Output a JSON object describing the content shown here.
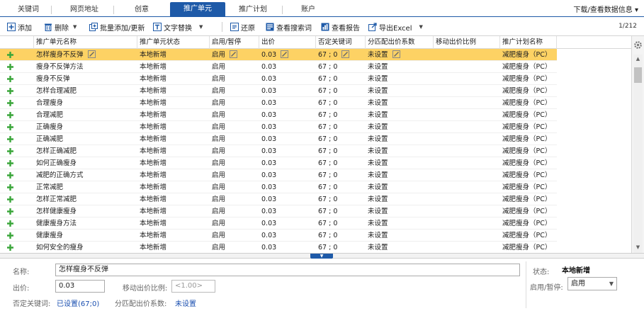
{
  "tabs": [
    {
      "label": "关键词",
      "active": false
    },
    {
      "label": "网页地址",
      "active": false
    },
    {
      "label": "创意",
      "active": false
    },
    {
      "label": "推广单元",
      "active": true
    },
    {
      "label": "推广计划",
      "active": false
    },
    {
      "label": "账户",
      "active": false
    }
  ],
  "header": {
    "download_link": "下载/查看数据信息 ▾"
  },
  "toolbar": {
    "add": "添加",
    "delete": "删除",
    "batch": "批量添加/更新",
    "replace": "文字替换",
    "restore": "还原",
    "search_terms": "查看搜索词",
    "report": "查看报告",
    "export": "导出Excel",
    "pager": "1/212"
  },
  "columns": [
    "推广单元名称",
    "推广单元状态",
    "启用/暂停",
    "出价",
    "否定关键词",
    "分匹配出价系数",
    "移动出价比例",
    "推广计划名称"
  ],
  "rows": [
    {
      "name": "怎样瘦身不反弹",
      "status": "本地新增",
      "enabled": "启用",
      "bid": "0.03",
      "neg": "67 ; 0",
      "match": "未设置",
      "mobile": "",
      "plan": "减肥瘦身（PC）",
      "selected": true
    },
    {
      "name": "瘦身不反弹方法",
      "status": "本地新增",
      "enabled": "启用",
      "bid": "0.03",
      "neg": "67 ; 0",
      "match": "未设置",
      "mobile": "",
      "plan": "减肥瘦身（PC）"
    },
    {
      "name": "瘦身不反弹",
      "status": "本地新增",
      "enabled": "启用",
      "bid": "0.03",
      "neg": "67 ; 0",
      "match": "未设置",
      "mobile": "",
      "plan": "减肥瘦身（PC）"
    },
    {
      "name": "怎样合理减肥",
      "status": "本地新增",
      "enabled": "启用",
      "bid": "0.03",
      "neg": "67 ; 0",
      "match": "未设置",
      "mobile": "",
      "plan": "减肥瘦身（PC）"
    },
    {
      "name": "合理瘦身",
      "status": "本地新增",
      "enabled": "启用",
      "bid": "0.03",
      "neg": "67 ; 0",
      "match": "未设置",
      "mobile": "",
      "plan": "减肥瘦身（PC）"
    },
    {
      "name": "合理减肥",
      "status": "本地新增",
      "enabled": "启用",
      "bid": "0.03",
      "neg": "67 ; 0",
      "match": "未设置",
      "mobile": "",
      "plan": "减肥瘦身（PC）"
    },
    {
      "name": "正确瘦身",
      "status": "本地新增",
      "enabled": "启用",
      "bid": "0.03",
      "neg": "67 ; 0",
      "match": "未设置",
      "mobile": "",
      "plan": "减肥瘦身（PC）"
    },
    {
      "name": "正确减肥",
      "status": "本地新增",
      "enabled": "启用",
      "bid": "0.03",
      "neg": "67 ; 0",
      "match": "未设置",
      "mobile": "",
      "plan": "减肥瘦身（PC）"
    },
    {
      "name": "怎样正确减肥",
      "status": "本地新增",
      "enabled": "启用",
      "bid": "0.03",
      "neg": "67 ; 0",
      "match": "未设置",
      "mobile": "",
      "plan": "减肥瘦身（PC）"
    },
    {
      "name": "如何正确瘦身",
      "status": "本地新增",
      "enabled": "启用",
      "bid": "0.03",
      "neg": "67 ; 0",
      "match": "未设置",
      "mobile": "",
      "plan": "减肥瘦身（PC）"
    },
    {
      "name": "减肥的正确方式",
      "status": "本地新增",
      "enabled": "启用",
      "bid": "0.03",
      "neg": "67 ; 0",
      "match": "未设置",
      "mobile": "",
      "plan": "减肥瘦身（PC）"
    },
    {
      "name": "正常减肥",
      "status": "本地新增",
      "enabled": "启用",
      "bid": "0.03",
      "neg": "67 ; 0",
      "match": "未设置",
      "mobile": "",
      "plan": "减肥瘦身（PC）"
    },
    {
      "name": "怎样正常减肥",
      "status": "本地新增",
      "enabled": "启用",
      "bid": "0.03",
      "neg": "67 ; 0",
      "match": "未设置",
      "mobile": "",
      "plan": "减肥瘦身（PC）"
    },
    {
      "name": "怎样健康瘦身",
      "status": "本地新增",
      "enabled": "启用",
      "bid": "0.03",
      "neg": "67 ; 0",
      "match": "未设置",
      "mobile": "",
      "plan": "减肥瘦身（PC）"
    },
    {
      "name": "健康瘦身方法",
      "status": "本地新增",
      "enabled": "启用",
      "bid": "0.03",
      "neg": "67 ; 0",
      "match": "未设置",
      "mobile": "",
      "plan": "减肥瘦身（PC）"
    },
    {
      "name": "健康瘦身",
      "status": "本地新增",
      "enabled": "启用",
      "bid": "0.03",
      "neg": "67 ; 0",
      "match": "未设置",
      "mobile": "",
      "plan": "减肥瘦身（PC）"
    },
    {
      "name": "如何安全的瘦身",
      "status": "本地新增",
      "enabled": "启用",
      "bid": "0.03",
      "neg": "67 ; 0",
      "match": "未设置",
      "mobile": "",
      "plan": "减肥瘦身（PC）"
    }
  ],
  "detail": {
    "name_label": "名称:",
    "name_value": "怎样瘦身不反弹",
    "bid_label": "出价:",
    "bid_value": "0.03",
    "mobile_label": "移动出价比例:",
    "mobile_placeholder": "<1.00>",
    "neg_label": "否定关键词:",
    "neg_value": "已设置(67;0)",
    "match_label": "分匹配出价系数:",
    "match_value": "未设置",
    "status_label": "状态:",
    "status_value": "本地新增",
    "enable_label": "启用/暂停:",
    "enable_value": "启用"
  },
  "colors": {
    "accent": "#1e5aa8",
    "selected_row": "#fdd264",
    "plus_icon": "#3aa63a"
  }
}
